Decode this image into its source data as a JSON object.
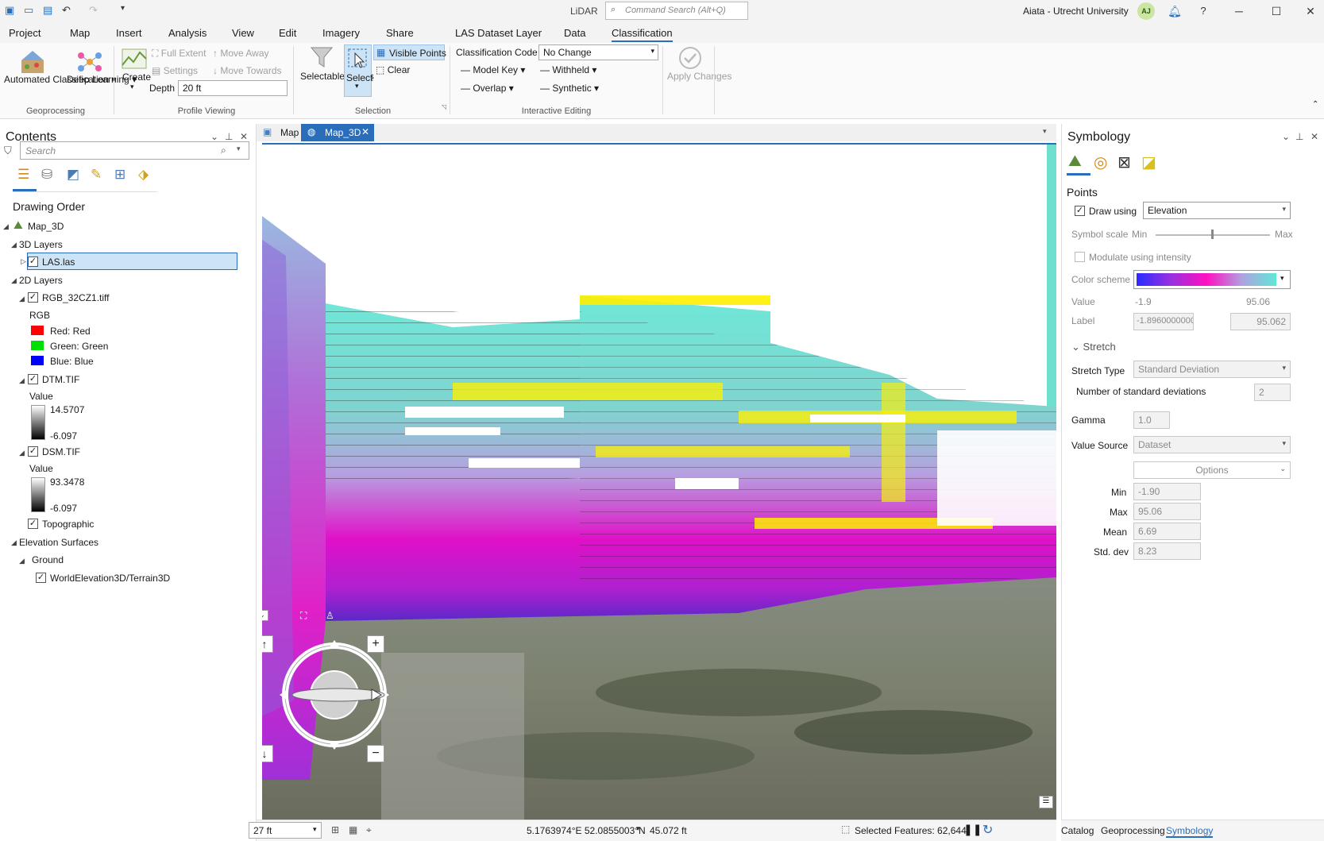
{
  "titlebar": {
    "app_title": "LiDAR",
    "command_search_placeholder": "Command Search (Alt+Q)",
    "user": "Aiata - Utrecht University",
    "avatar_initials": "AJ",
    "help": "?"
  },
  "ribbon_tabs": [
    "Project",
    "Map",
    "Insert",
    "Analysis",
    "View",
    "Edit",
    "Imagery",
    "Share",
    "LAS Dataset Layer",
    "Data",
    "Classification"
  ],
  "active_tab": "Classification",
  "ribbon": {
    "geoprocessing": {
      "automated_classification": "Automated Classification",
      "deep_learning": "Deep Learning",
      "label": "Geoprocessing"
    },
    "profile_viewing": {
      "create": "Create",
      "full_extent": "Full Extent",
      "settings": "Settings",
      "move_away": "Move Away",
      "move_towards": "Move Towards",
      "depth_label": "Depth",
      "depth_value": "20 ft",
      "label": "Profile Viewing"
    },
    "selection": {
      "selectable_points": "Selectable Points",
      "select": "Select",
      "visible_points": "Visible Points",
      "clear": "Clear",
      "label": "Selection"
    },
    "interactive_editing": {
      "classification_code_label": "Classification Code",
      "classification_code_value": "No Change",
      "model_key": "Model Key",
      "withheld": "Withheld",
      "overlap": "Overlap",
      "synthetic": "Synthetic",
      "label": "Interactive Editing"
    },
    "apply_changes": "Apply Changes"
  },
  "contents": {
    "title": "Contents",
    "search_placeholder": "Search",
    "drawing_order": "Drawing Order",
    "map_name": "Map_3D",
    "layers_3d": "3D Layers",
    "las_layer": "LAS.las",
    "layers_2d": "2D Layers",
    "rgb_layer": "RGB_32CZ1.tiff",
    "rgb_label": "RGB",
    "rgb_bands": [
      {
        "label": "Red:  Red",
        "color": "#ff0000"
      },
      {
        "label": "Green: Green",
        "color": "#00e000"
      },
      {
        "label": "Blue:  Blue",
        "color": "#0000ff"
      }
    ],
    "dtm_layer": "DTM.TIF",
    "dtm_value_label": "Value",
    "dtm_max": "14.5707",
    "dtm_min": "-6.097",
    "dsm_layer": "DSM.TIF",
    "dsm_value_label": "Value",
    "dsm_max": "93.3478",
    "dsm_min": "-6.097",
    "topographic": "Topographic",
    "elevation_surfaces": "Elevation Surfaces",
    "ground": "Ground",
    "terrain": "WorldElevation3D/Terrain3D"
  },
  "map_tabs": {
    "map": "Map",
    "map3d": "Map_3D"
  },
  "status_bar": {
    "scale": "27 ft",
    "coordinates": "5.1763974°E 52.0855003°N",
    "elevation": "45.072 ft",
    "selected_features": "Selected Features: 62,644"
  },
  "symbology": {
    "title": "Symbology",
    "points": "Points",
    "draw_using_label": "Draw using",
    "draw_using_value": "Elevation",
    "symbol_scale": "Symbol scale",
    "symbol_scale_min": "Min",
    "symbol_scale_max": "Max",
    "modulate": "Modulate using intensity",
    "color_scheme": "Color scheme",
    "value_label": "Value",
    "value_min": "-1.9",
    "value_max": "95.06",
    "label_label": "Label",
    "label_min": "-1.8960000000",
    "label_max": "95.062",
    "stretch": "Stretch",
    "stretch_type_label": "Stretch Type",
    "stretch_type_value": "Standard Deviation",
    "num_std_dev_label": "Number of standard deviations",
    "num_std_dev_value": "2",
    "gamma_label": "Gamma",
    "gamma_value": "1.0",
    "value_source_label": "Value Source",
    "value_source_value": "Dataset",
    "options": "Options",
    "stats": [
      {
        "label": "Min",
        "value": "-1.90"
      },
      {
        "label": "Max",
        "value": "95.06"
      },
      {
        "label": "Mean",
        "value": "6.69"
      },
      {
        "label": "Std. dev",
        "value": "8.23"
      }
    ]
  },
  "bottom_tabs": [
    "Catalog",
    "Geoprocessing",
    "Symbology"
  ]
}
